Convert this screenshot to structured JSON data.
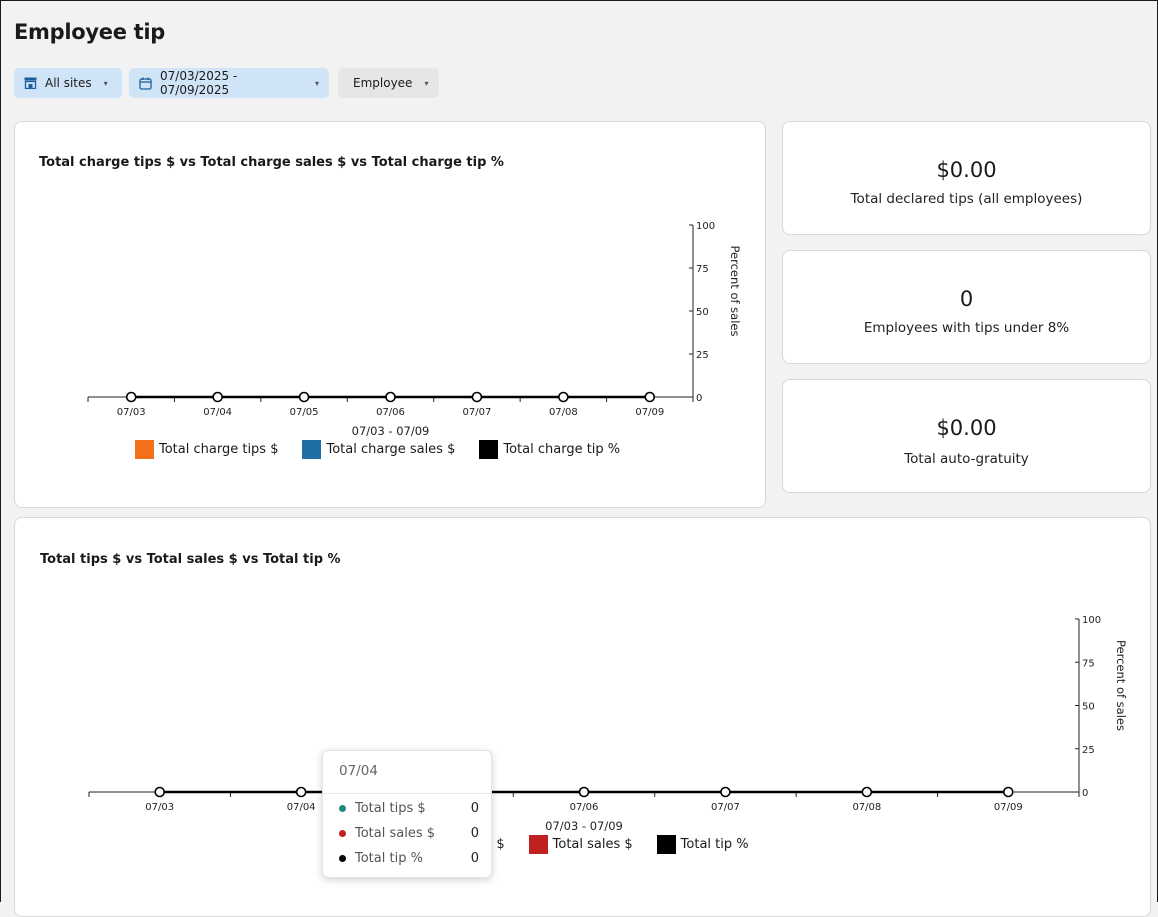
{
  "page": {
    "title": "Employee tip"
  },
  "filters": {
    "sites": {
      "label": "All sites",
      "icon": "store-icon"
    },
    "date": {
      "label": "07/03/2025 - 07/09/2025",
      "icon": "calendar-icon"
    },
    "employee": {
      "label": "Employee"
    }
  },
  "kpis": [
    {
      "value": "$0.00",
      "label": "Total declared tips (all employees)"
    },
    {
      "value": "0",
      "label": "Employees with tips under 8%"
    },
    {
      "value": "$0.00",
      "label": "Total auto-gratuity"
    }
  ],
  "chart_data": [
    {
      "type": "line",
      "title": "Total charge tips $ vs Total charge sales $ vs Total charge tip %",
      "categories": [
        "07/03",
        "07/04",
        "07/05",
        "07/06",
        "07/07",
        "07/08",
        "07/09"
      ],
      "xlabel": "07/03 - 07/09",
      "y2label": "Percent of sales",
      "y2ticks": [
        "0",
        "25",
        "50",
        "75",
        "100"
      ],
      "y2lim": [
        0,
        100
      ],
      "series": [
        {
          "name": "Total charge tips $",
          "color": "#f5701a",
          "values": [
            0,
            0,
            0,
            0,
            0,
            0,
            0
          ]
        },
        {
          "name": "Total charge sales $",
          "color": "#1c6ea4",
          "values": [
            0,
            0,
            0,
            0,
            0,
            0,
            0
          ]
        },
        {
          "name": "Total charge tip %",
          "color": "#000000",
          "values": [
            0,
            0,
            0,
            0,
            0,
            0,
            0
          ]
        }
      ],
      "legend_position": "bottom"
    },
    {
      "type": "line",
      "title": "Total tips $ vs Total sales $ vs Total tip %",
      "categories": [
        "07/03",
        "07/04",
        "07/05",
        "07/06",
        "07/07",
        "07/08",
        "07/09"
      ],
      "xlabel": "07/03 - 07/09",
      "y2label": "Percent of sales",
      "y2ticks": [
        "0",
        "25",
        "50",
        "75",
        "100"
      ],
      "y2lim": [
        0,
        100
      ],
      "series": [
        {
          "name": "Total tips $",
          "color": "#1e8a7e",
          "values": [
            0,
            0,
            0,
            0,
            0,
            0,
            0
          ]
        },
        {
          "name": "Total sales $",
          "color": "#c0201f",
          "values": [
            0,
            0,
            0,
            0,
            0,
            0,
            0
          ]
        },
        {
          "name": "Total tip %",
          "color": "#000000",
          "values": [
            0,
            0,
            0,
            0,
            0,
            0,
            0
          ]
        }
      ],
      "legend_position": "bottom"
    }
  ],
  "tooltip": {
    "header": "07/04",
    "rows": [
      {
        "label": "Total tips $",
        "value": "0",
        "color": "#1e8a7e"
      },
      {
        "label": "Total sales $",
        "value": "0",
        "color": "#c0201f"
      },
      {
        "label": "Total tip %",
        "value": "0",
        "color": "#000000"
      }
    ]
  }
}
